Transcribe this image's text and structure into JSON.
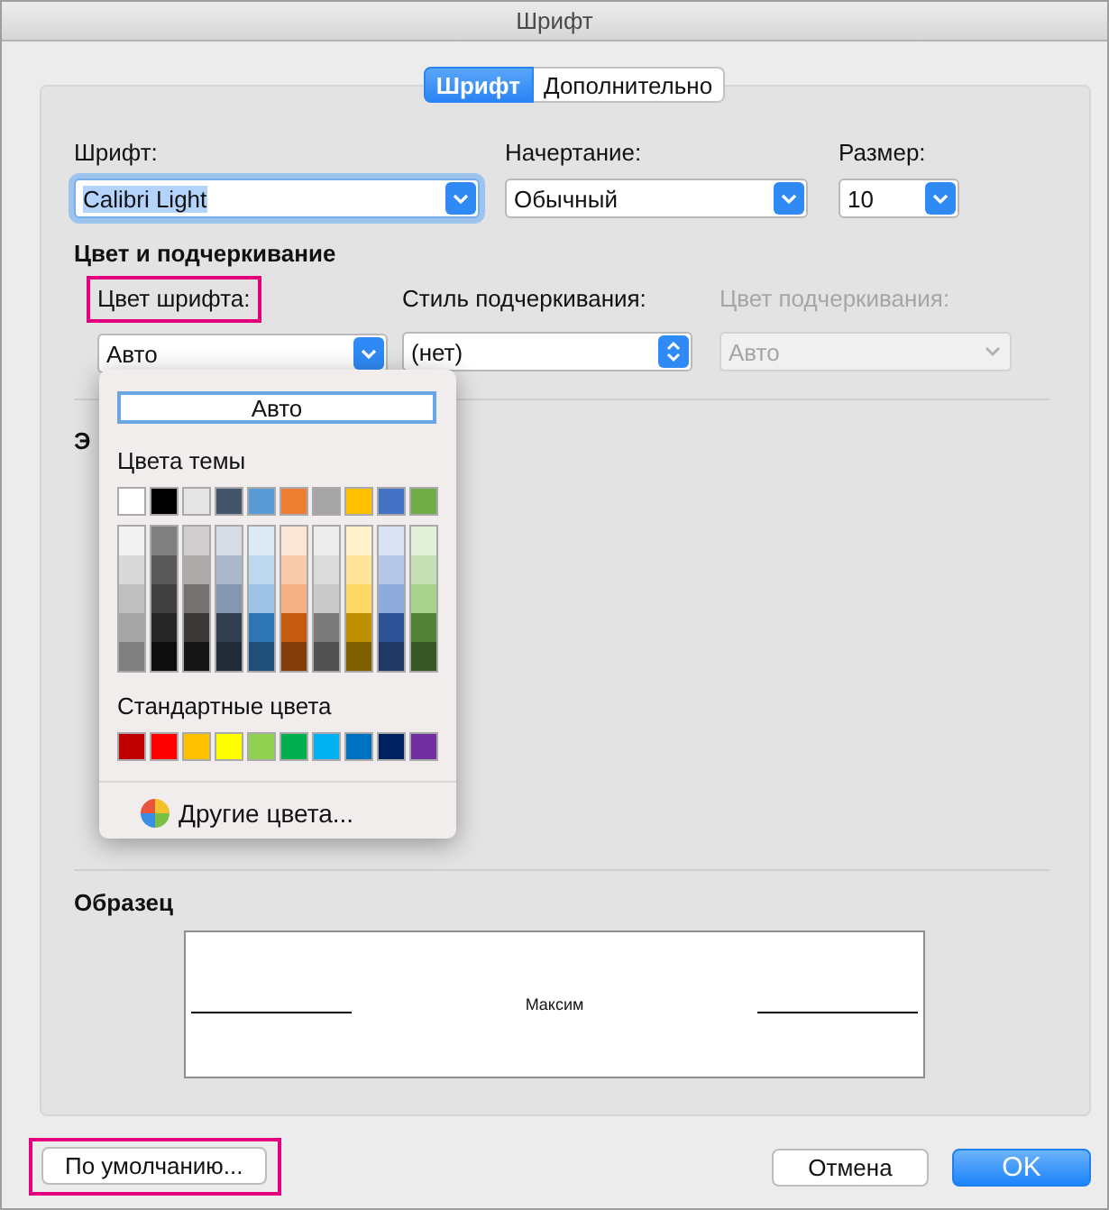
{
  "window": {
    "title": "Шрифт"
  },
  "tabs": [
    {
      "label": "Шрифт",
      "selected": true
    },
    {
      "label": "Дополнительно",
      "selected": false
    }
  ],
  "font_fields": [
    {
      "label": "Шрифт:",
      "value": "Calibri Light",
      "focused": true
    },
    {
      "label": "Начертание:",
      "value": "Обычный",
      "focused": false
    },
    {
      "label": "Размер:",
      "value": "10",
      "focused": false
    }
  ],
  "color_section": {
    "heading": "Цвет и подчеркивание",
    "fields": [
      {
        "label": "Цвет шрифта:",
        "value": "Авто",
        "highlighted": true,
        "disabled": false,
        "kind": "dropdown"
      },
      {
        "label": "Стиль подчеркивания:",
        "value": "(нет)",
        "highlighted": false,
        "disabled": false,
        "kind": "stepper"
      },
      {
        "label": "Цвет подчеркивания:",
        "value": "Авто",
        "highlighted": false,
        "disabled": true,
        "kind": "dropdown"
      }
    ]
  },
  "effects_section": {
    "heading": "Э"
  },
  "color_menu": {
    "auto_label": "Авто",
    "theme_heading": "Цвета темы",
    "theme_colors": [
      {
        "color": "#ffffff",
        "shades": [
          {
            "color": "#f2f2f2"
          },
          {
            "color": "#d9d9d9"
          },
          {
            "color": "#bfbfbf"
          },
          {
            "color": "#a6a6a6"
          },
          {
            "color": "#808080"
          }
        ]
      },
      {
        "color": "#000000",
        "shades": [
          {
            "color": "#808080"
          },
          {
            "color": "#595959"
          },
          {
            "color": "#404040"
          },
          {
            "color": "#262626"
          },
          {
            "color": "#0d0d0d"
          }
        ]
      },
      {
        "color": "#e7e6e6",
        "shades": [
          {
            "color": "#d0cece"
          },
          {
            "color": "#aeaaaa"
          },
          {
            "color": "#757171"
          },
          {
            "color": "#3b3838"
          },
          {
            "color": "#171616"
          }
        ]
      },
      {
        "color": "#44546a",
        "shades": [
          {
            "color": "#d6dce4"
          },
          {
            "color": "#adb9ca"
          },
          {
            "color": "#8496b0"
          },
          {
            "color": "#323f4f"
          },
          {
            "color": "#222a35"
          }
        ]
      },
      {
        "color": "#5b9bd5",
        "shades": [
          {
            "color": "#deebf6"
          },
          {
            "color": "#bdd7ee"
          },
          {
            "color": "#9dc3e6"
          },
          {
            "color": "#2e75b5"
          },
          {
            "color": "#1f4e79"
          }
        ]
      },
      {
        "color": "#ed7d31",
        "shades": [
          {
            "color": "#fbe5d5"
          },
          {
            "color": "#f8cbad"
          },
          {
            "color": "#f4b183"
          },
          {
            "color": "#c55a11"
          },
          {
            "color": "#843c0b"
          }
        ]
      },
      {
        "color": "#a5a5a5",
        "shades": [
          {
            "color": "#ededed"
          },
          {
            "color": "#dbdbdb"
          },
          {
            "color": "#c9c9c9"
          },
          {
            "color": "#7b7b7b"
          },
          {
            "color": "#525252"
          }
        ]
      },
      {
        "color": "#ffc000",
        "shades": [
          {
            "color": "#fff2cc"
          },
          {
            "color": "#fee599"
          },
          {
            "color": "#ffd965"
          },
          {
            "color": "#bf9000"
          },
          {
            "color": "#7f6000"
          }
        ]
      },
      {
        "color": "#4472c4",
        "shades": [
          {
            "color": "#dae3f3"
          },
          {
            "color": "#b4c7e7"
          },
          {
            "color": "#8faadc"
          },
          {
            "color": "#2f5496"
          },
          {
            "color": "#1f3864"
          }
        ]
      },
      {
        "color": "#70ad47",
        "shades": [
          {
            "color": "#e2f0d9"
          },
          {
            "color": "#c5e0b4"
          },
          {
            "color": "#a9d18e"
          },
          {
            "color": "#538135"
          },
          {
            "color": "#375623"
          }
        ]
      }
    ],
    "standard_heading": "Стандартные цвета",
    "standard_colors": [
      {
        "color": "#c00000"
      },
      {
        "color": "#ff0000"
      },
      {
        "color": "#ffc000"
      },
      {
        "color": "#ffff00"
      },
      {
        "color": "#92d050"
      },
      {
        "color": "#00b050"
      },
      {
        "color": "#00b0f0"
      },
      {
        "color": "#0070c0"
      },
      {
        "color": "#002060"
      },
      {
        "color": "#7030a0"
      }
    ],
    "more_label": "Другие цвета..."
  },
  "preview": {
    "heading": "Образец",
    "sample": "Максим"
  },
  "buttons": [
    {
      "label": "По умолчанию...",
      "highlighted": true,
      "kind": "secondary"
    },
    {
      "label": "Отмена",
      "highlighted": false,
      "kind": "secondary"
    },
    {
      "label": "OK",
      "highlighted": false,
      "kind": "default"
    }
  ]
}
